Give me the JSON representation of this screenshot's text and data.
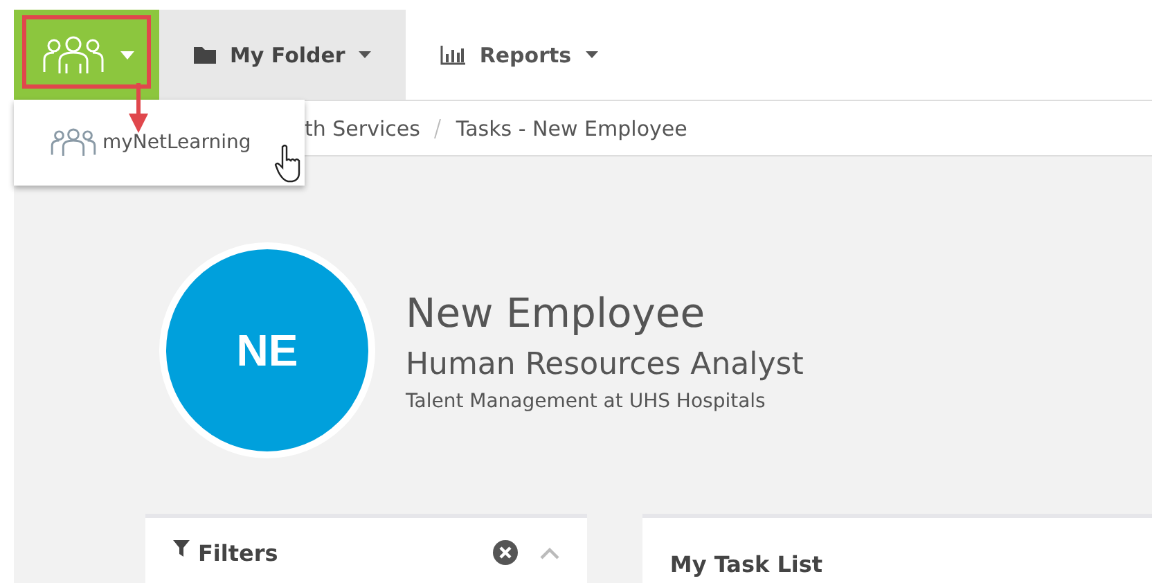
{
  "app_switcher": {
    "expanded": true,
    "menu_items": [
      {
        "label": "myNetLearning"
      }
    ]
  },
  "nav_items": [
    {
      "label": "My Folder",
      "kind": "folder",
      "selected": true
    },
    {
      "label": "Reports",
      "kind": "chart",
      "selected": false
    }
  ],
  "breadcrumb": [
    "th Services",
    "Tasks - New Employee"
  ],
  "profile": {
    "initials": "NE",
    "name": "New Employee",
    "title": "Human Resources Analyst",
    "organization": "Talent Management at UHS Hospitals"
  },
  "filters_panel": {
    "title": "Filters"
  },
  "task_panel": {
    "title": "My Task List"
  }
}
